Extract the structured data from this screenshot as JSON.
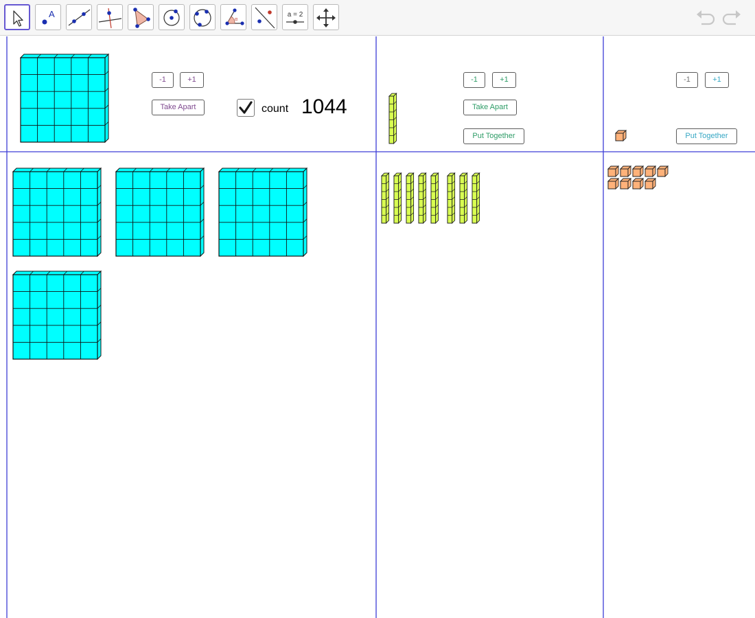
{
  "toolbar": {
    "tools": [
      {
        "name": "move-tool",
        "icon": "arrow-cursor-icon",
        "selected": true
      },
      {
        "name": "point-tool",
        "icon": "point-a-icon"
      },
      {
        "name": "line-tool",
        "icon": "line-through-points-icon"
      },
      {
        "name": "perpendicular-line-tool",
        "icon": "perpendicular-line-icon"
      },
      {
        "name": "polygon-tool",
        "icon": "polygon-icon"
      },
      {
        "name": "circle-tool",
        "icon": "circle-center-point-icon"
      },
      {
        "name": "circle-three-points-tool",
        "icon": "circle-three-points-icon"
      },
      {
        "name": "angle-tool",
        "icon": "angle-icon"
      },
      {
        "name": "reflect-tool",
        "icon": "reflect-about-line-icon"
      },
      {
        "name": "slider-tool",
        "icon": "slider-icon",
        "label": "a = 2"
      },
      {
        "name": "move-graphics-view-tool",
        "icon": "move-arrows-icon"
      }
    ],
    "undo_icon": "undo-icon",
    "redo_icon": "redo-icon"
  },
  "thousands_panel": {
    "minus_label": "-1",
    "plus_label": "+1",
    "take_apart_label": "Take Apart",
    "count_checked": true,
    "count_label": "count",
    "count_value": "1044",
    "blocks_on_mat": 4
  },
  "tens_panel": {
    "minus_label": "-1",
    "plus_label": "+1",
    "take_apart_label": "Take Apart",
    "put_together_label": "Put Together",
    "rods_on_mat": 8
  },
  "ones_panel": {
    "minus_label": "-1",
    "plus_label": "+1",
    "put_together_label": "Put Together",
    "cubes_on_mat": 9
  },
  "colors": {
    "thousand": "#00ffff",
    "ten": "#d9ff52",
    "one": "#ffb27a",
    "grid_line": "#3c3cd6",
    "accent": "#6557d2"
  }
}
